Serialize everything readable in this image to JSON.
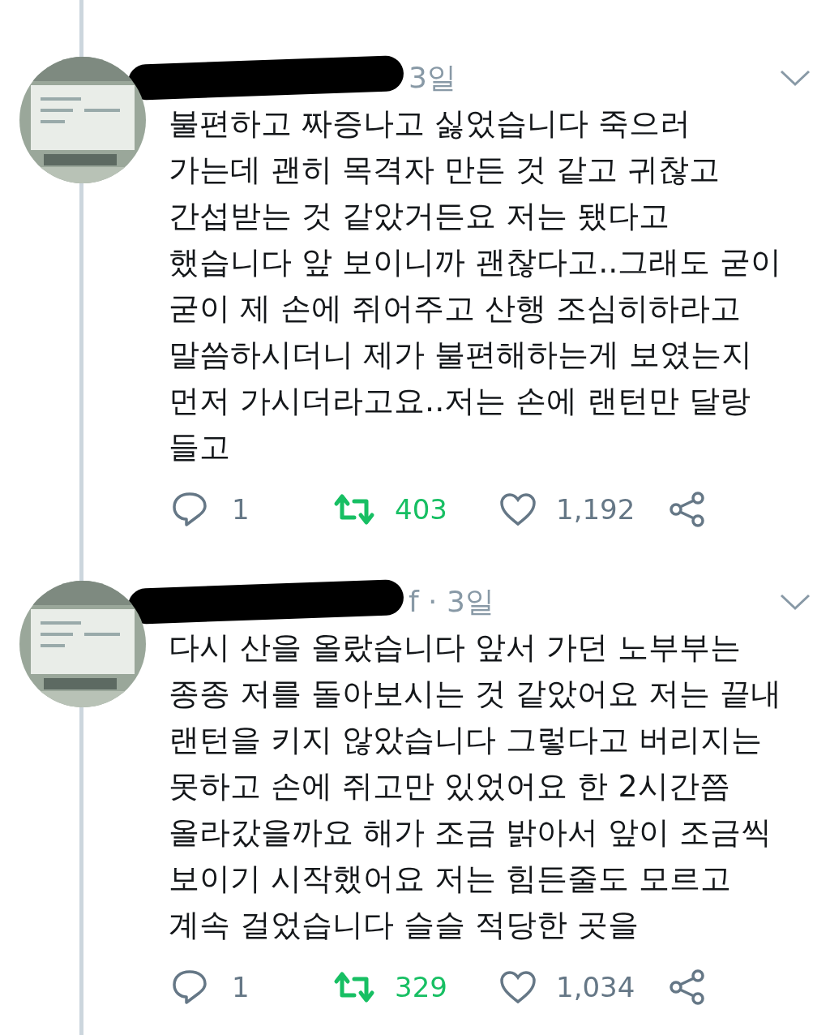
{
  "tweets": [
    {
      "meta": "3일",
      "text": "불편하고 짜증나고 싫었습니다 죽으러\n가는데 괜히 목격자 만든 것 같고 귀찮고\n간섭받는 것 같았거든요 저는 됐다고\n했습니다 앞 보이니까 괜찮다고..그래도 굳이\n굳이 제 손에 쥐어주고 산행 조심히하라고\n말씀하시더니 제가 불편해하는게 보였는지\n먼저 가시더라고요..저는 손에 랜턴만 달랑\n들고",
      "replies": "1",
      "retweets": "403",
      "retweeted": true,
      "likes": "1,192",
      "liked": false
    },
    {
      "meta": "f · 3일",
      "text": "다시 산을 올랐습니다 앞서 가던 노부부는\n종종 저를 돌아보시는 것 같았어요 저는 끝내\n랜턴을 키지 않았습니다 그렇다고 버리지는\n못하고 손에 쥐고만 있었어요 한 2시간쯤\n올라갔을까요 해가 조금 밝아서 앞이 조금씩\n보이기 시작했어요 저는 힘든줄도 모르고\n계속 걸었습니다 슬슬 적당한 곳을",
      "replies": "1",
      "retweets": "329",
      "retweeted": true,
      "likes": "1,034",
      "liked": false
    }
  ]
}
